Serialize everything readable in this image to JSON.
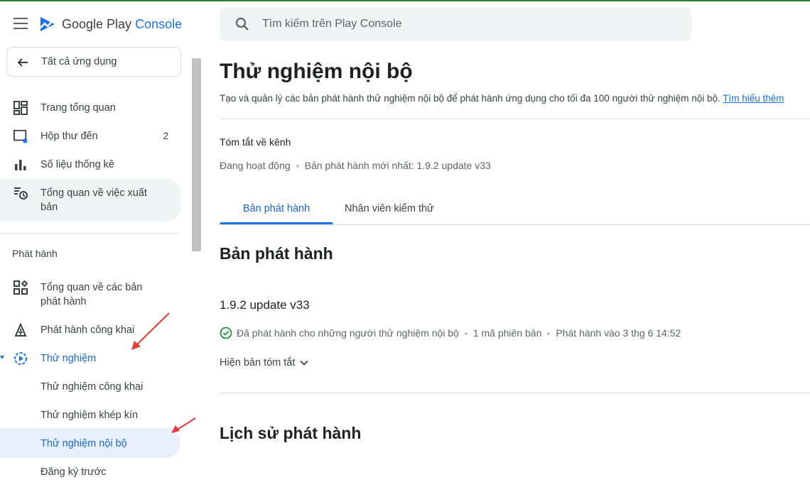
{
  "brand": {
    "name_prefix": "Google Play ",
    "name_suffix": "Console"
  },
  "search": {
    "placeholder": "Tìm kiếm trên Play Console"
  },
  "sidebar": {
    "back_label": "Tất cả ứng dụng",
    "items": [
      {
        "label": "Trang tổng quan"
      },
      {
        "label": "Hộp thư đến",
        "count": "2"
      },
      {
        "label": "Số liệu thống kê"
      },
      {
        "label": "Tổng quan về việc xuất bản"
      }
    ],
    "section_title": "Phát hành",
    "release_items": [
      {
        "label": "Tổng quan về các bản phát hành"
      },
      {
        "label": "Phát hành công khai"
      },
      {
        "label": "Thử nghiệm"
      },
      {
        "label": "Thử nghiệm công khai"
      },
      {
        "label": "Thử nghiệm khép kín"
      },
      {
        "label": "Thử nghiệm nội bộ"
      },
      {
        "label": "Đăng ký trước"
      }
    ]
  },
  "main": {
    "title": "Thử nghiệm nội bộ",
    "description": "Tạo và quản lý các bản phát hành thử nghiệm nội bộ để phát hành ứng dụng cho tối đa 100 người thử nghiệm nội bộ.",
    "learn_more": "Tìm hiểu thêm",
    "channel_summary": {
      "title": "Tóm tắt về kênh",
      "status": "Đang hoạt động",
      "latest_release": "Bản phát hành mới nhất: 1.9.2 update v33"
    },
    "tabs": [
      {
        "label": "Bản phát hành"
      },
      {
        "label": "Nhân viên kiểm thử"
      }
    ],
    "releases_heading": "Bản phát hành",
    "release": {
      "version": "1.9.2 update v33",
      "status": "Đã phát hành cho những người thử nghiệm nội bộ",
      "version_codes": "1 mã phiên bản",
      "release_time": "Phát hành vào 3 thg 6 14:52"
    },
    "show_summary": "Hiện bản tóm tắt",
    "history_heading": "Lịch sử phát hành"
  },
  "colors": {
    "accent": "#1a73e8",
    "selected_bg": "#e8f0fe",
    "annotation": "#e53935"
  }
}
